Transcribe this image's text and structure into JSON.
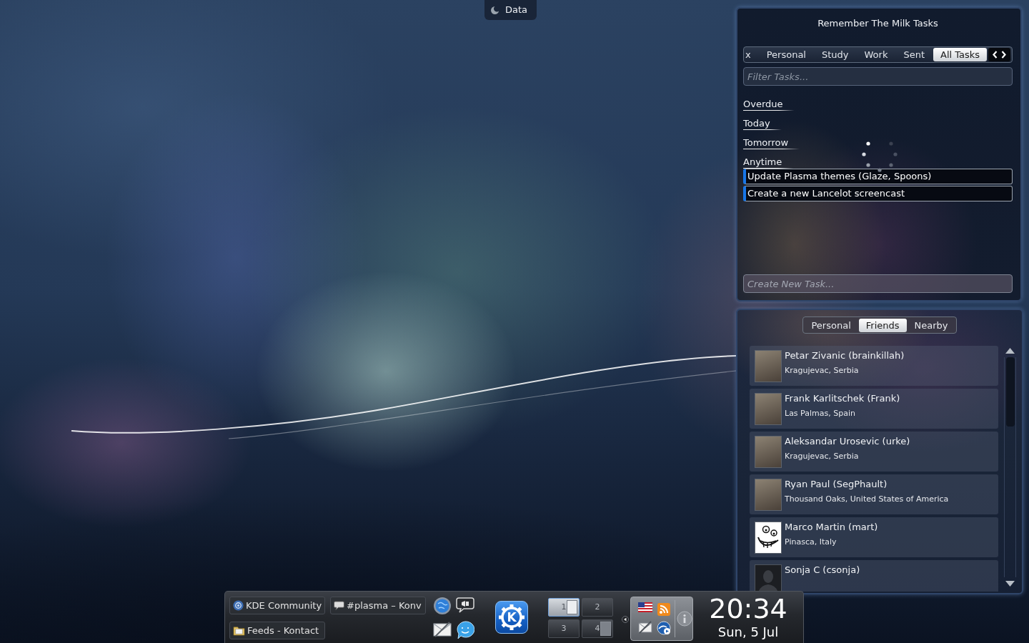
{
  "toolbox": {
    "label": "Data"
  },
  "tasks_widget": {
    "title": "Remember The Milk Tasks",
    "tabs": [
      {
        "label": "x",
        "selected": false
      },
      {
        "label": "Personal",
        "selected": false
      },
      {
        "label": "Study",
        "selected": false
      },
      {
        "label": "Work",
        "selected": false
      },
      {
        "label": "Sent",
        "selected": false
      },
      {
        "label": "All Tasks",
        "selected": true
      }
    ],
    "filter": {
      "placeholder": "Filter Tasks..."
    },
    "groups": [
      {
        "heading": "Overdue"
      },
      {
        "heading": "Today"
      },
      {
        "heading": "Tomorrow"
      },
      {
        "heading": "Anytime",
        "tasks": [
          {
            "title": "Update Plasma themes (Glaze, Spoons)"
          },
          {
            "title": "Create a new Lancelot screencast"
          }
        ]
      }
    ],
    "new_task": {
      "placeholder": "Create New Task..."
    }
  },
  "social_widget": {
    "tabs": [
      {
        "label": "Personal",
        "selected": false
      },
      {
        "label": "Friends",
        "selected": true
      },
      {
        "label": "Nearby",
        "selected": false
      }
    ],
    "contacts": [
      {
        "name": "Petar Zivanic (brainkillah)",
        "location": "Kragujevac, Serbia",
        "kind": "photo"
      },
      {
        "name": "Frank Karlitschek (Frank)",
        "location": "Las Palmas, Spain",
        "kind": "photo"
      },
      {
        "name": "Aleksandar Urosevic (urke)",
        "location": "Kragujevac, Serbia",
        "kind": "photo"
      },
      {
        "name": "Ryan Paul (SegPhault)",
        "location": "Thousand Oaks, United States of America",
        "kind": "photo"
      },
      {
        "name": "Marco Martin (mart)",
        "location": "Pinasca, Italy",
        "kind": "drawing"
      },
      {
        "name": "Sonja C (csonja)",
        "kind": "silhouette"
      }
    ]
  },
  "panel": {
    "tasks": [
      {
        "label": "KDE Community",
        "kind": "globe"
      },
      {
        "label": "#plasma – Konv",
        "kind": "chat"
      },
      {
        "label": "Feeds - Kontact",
        "kind": "folder"
      }
    ],
    "launcher": {
      "label": "K"
    },
    "desktops": [
      {
        "label": "1",
        "selected": true,
        "occupied": true
      },
      {
        "label": "2",
        "selected": false,
        "occupied": false
      },
      {
        "label": "3",
        "selected": false,
        "occupied": false
      },
      {
        "label": "4",
        "selected": false,
        "occupied": true
      }
    ],
    "clock": {
      "time": "20:34",
      "date": "Sun, 5 Jul"
    }
  }
}
